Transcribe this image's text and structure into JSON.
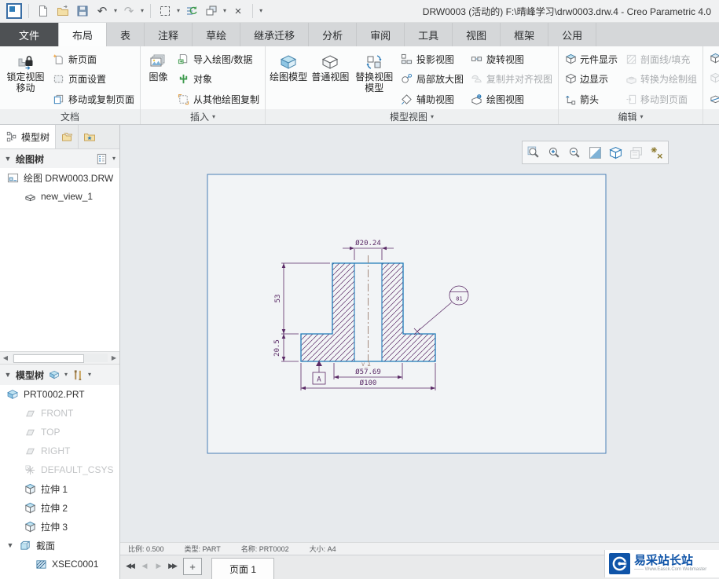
{
  "icons": {
    "dropdown": "▾",
    "expand": "▼",
    "scroll_left": "◀",
    "scroll_right": "▶",
    "first": "◀◀",
    "prev": "◀",
    "next": "▶",
    "last": "▶▶",
    "plus": "+",
    "close": "×",
    "undo": "↶",
    "redo": "↷",
    "plane": "▱"
  },
  "titlebar": {
    "title": "DRW0003 (活动的) F:\\晴峰学习\\drw0003.drw.4 - Creo Parametric 4.0"
  },
  "tabs": {
    "file": "文件",
    "layout": "布局",
    "table": "表",
    "annotate": "注释",
    "sketch": "草绘",
    "legacy": "继承迁移",
    "analysis": "分析",
    "review": "审阅",
    "tools": "工具",
    "view": "视图",
    "frame": "框架",
    "common": "公用"
  },
  "ribbon": {
    "doc": {
      "label": "文档",
      "big1": "锁定视图",
      "big2": "移动",
      "new_page": "新页面",
      "page_setup": "页面设置",
      "move_copy_page": "移动或复制页面"
    },
    "insert": {
      "label": "插入",
      "image": "图像",
      "import": "导入绘图/数据",
      "object": "对象",
      "copy_from": "从其他绘图复制"
    },
    "views": {
      "label": "模型视图",
      "drawing_model": "绘图模型",
      "general_view": "普通视图",
      "replace1": "替换视图",
      "replace2": "模型",
      "projection": "投影视图",
      "detail": "局部放大图",
      "auxiliary": "辅助视图",
      "revolve": "旋转视图",
      "copy_align": "复制并对齐视图",
      "drawing_view": "绘图视图"
    },
    "edit": {
      "label": "编辑",
      "component_display": "元件显示",
      "edge_display": "边显示",
      "arrows": "箭头",
      "hatch": "剖面线/填充",
      "convert": "转换为绘制组",
      "move_to_page": "移动到页面"
    }
  },
  "navigator": {
    "model_tree_tab": "模型树",
    "drawing_tree": {
      "title": "绘图树",
      "root": "绘图 DRW0003.DRW",
      "view": "new_view_1"
    },
    "model_tree": {
      "title": "模型树",
      "part": "PRT0002.PRT",
      "front": "FRONT",
      "top": "TOP",
      "right": "RIGHT",
      "csys": "DEFAULT_CSYS",
      "ext1": "拉伸 1",
      "ext2": "拉伸 2",
      "ext3": "拉伸 3",
      "section": "截面",
      "xsec": "XSEC0001"
    }
  },
  "drawing": {
    "hole_dia": "Ø20.24",
    "height": "53",
    "flange_height": "20.5",
    "mid_dia": "Ø57.69",
    "outer_dia": "Ø100",
    "datum": "A",
    "balloon": "81",
    "view_label": "V_1"
  },
  "statusbar": {
    "scale": "比例: 0.500",
    "type": "类型: PART",
    "name": "名称: PRT0002",
    "size": "大小: A4"
  },
  "pagebar": {
    "page": "页面 1"
  },
  "watermark": {
    "name": "易采站长站",
    "sub": "—— Www.Easck.Com Webmaster"
  }
}
